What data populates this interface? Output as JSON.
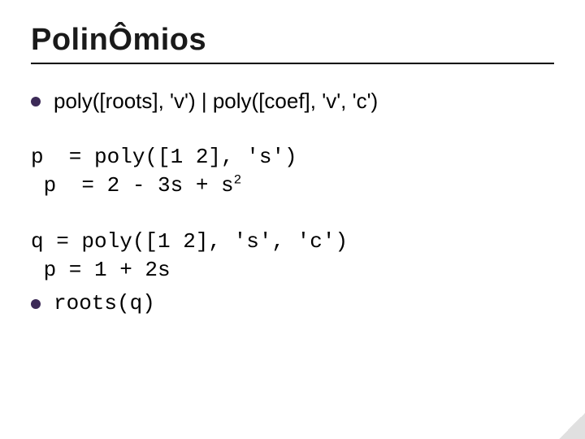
{
  "title": "PolinÔmios",
  "bullets": {
    "syntax": "poly([roots], 'v')  |  poly([coef], 'v', 'c')",
    "roots_call": "roots(q)"
  },
  "code1": {
    "line1": "p  = poly([1 2], 's')",
    "line2_prefix": " p  = 2 - 3s + s",
    "line2_exp": "2"
  },
  "code2": {
    "line1": "q = poly([1 2], 's', 'c')",
    "line2": " p = 1 + 2s"
  }
}
